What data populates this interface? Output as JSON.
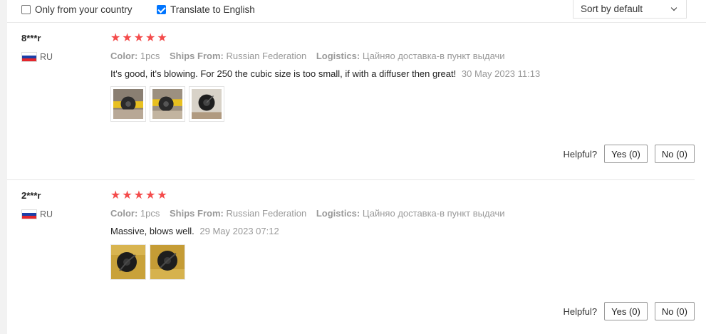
{
  "filters": {
    "only_country_label": "Only from your country",
    "only_country_checked": false,
    "translate_label": "Translate to English",
    "translate_checked": true,
    "sort_value": "Sort by default"
  },
  "reviews": [
    {
      "user": "8***r",
      "country": "RU",
      "rating": 5,
      "color_label": "Color:",
      "color_value": "1pcs",
      "ships_label": "Ships From:",
      "ships_value": "Russian Federation",
      "logistics_label": "Logistics:",
      "logistics_value": "Цайняо доставка-в пункт выдачи",
      "text": "It's good, it's blowing. For 250 the cubic size is too small, if with a diffuser then great!",
      "date": "30 May 2023 11:13",
      "helpful_label": "Helpful?",
      "yes_label": "Yes (0)",
      "no_label": "No (0)"
    },
    {
      "user": "2***r",
      "country": "RU",
      "rating": 5,
      "color_label": "Color:",
      "color_value": "1pcs",
      "ships_label": "Ships From:",
      "ships_value": "Russian Federation",
      "logistics_label": "Logistics:",
      "logistics_value": "Цайняо доставка-в пункт выдачи",
      "text": "Massive, blows well.",
      "date": "29 May 2023 07:12",
      "helpful_label": "Helpful?",
      "yes_label": "Yes (0)",
      "no_label": "No (0)"
    }
  ],
  "colors": {
    "star": "#f44b4b",
    "checkbox_checked": "#0075ff",
    "muted_text": "#999999"
  },
  "icons": {
    "star": "star-icon",
    "flag": "russia-flag-icon",
    "dropdown": "chevron-down-icon"
  }
}
